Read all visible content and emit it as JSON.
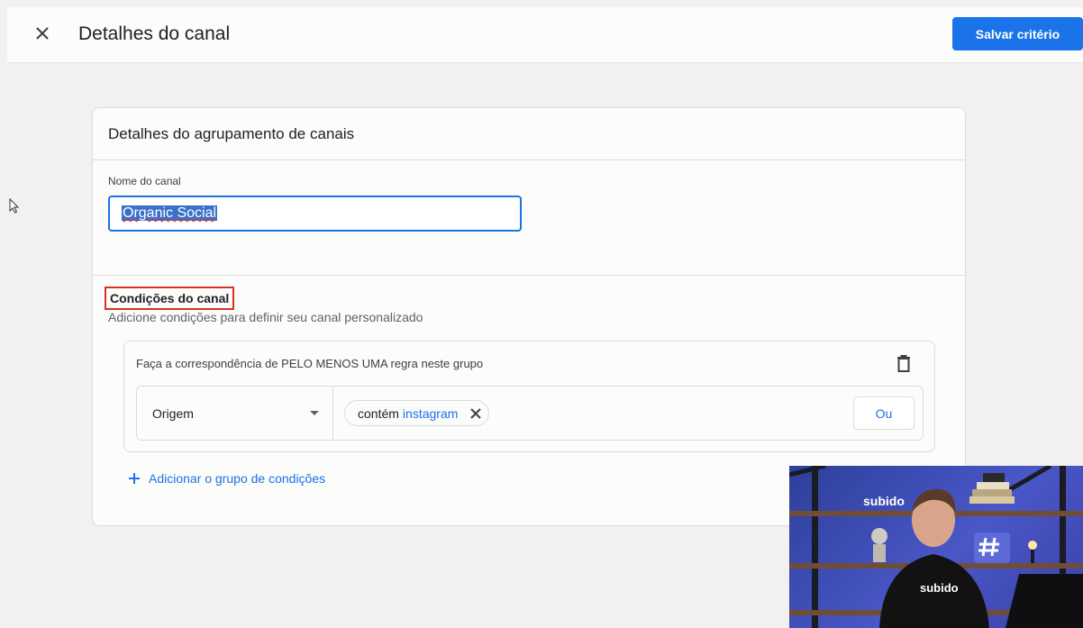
{
  "header": {
    "title": "Detalhes do canal",
    "save_label": "Salvar critério"
  },
  "card": {
    "title": "Detalhes do agrupamento de canais",
    "name_label": "Nome do canal",
    "name_value": "Organic Social"
  },
  "conditions": {
    "title": "Condições do canal",
    "subtitle": "Adicione condições para definir seu canal personalizado",
    "group_description": "Faça a correspondência de PELO MENOS UMA regra neste grupo",
    "rule": {
      "dimension": "Origem",
      "operator": "contém",
      "value": "instagram",
      "or_label": "Ou"
    },
    "add_group_label": "Adicionar o grupo de condições"
  },
  "webcam": {
    "shirt_text": "subido",
    "sign_text": "subido"
  },
  "colors": {
    "primary": "#1a73e8",
    "highlight_border": "#d93025",
    "selection": "#3b71c9"
  }
}
